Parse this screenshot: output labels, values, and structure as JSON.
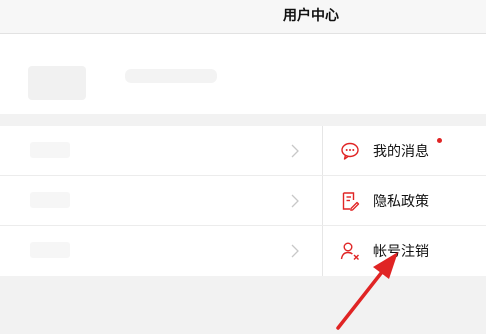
{
  "header": {
    "title": "用户中心"
  },
  "menu": {
    "items": [
      {
        "label": "我的消息",
        "icon": "message-icon",
        "has_unread_dot": true
      },
      {
        "label": "隐私政策",
        "icon": "policy-document-icon"
      },
      {
        "label": "帐号注销",
        "icon": "account-delete-icon"
      }
    ]
  },
  "colors": {
    "accent_red": "#e02424",
    "text_primary": "#111111",
    "background": "#f2f2f2",
    "chevron": "#c8c8c8"
  }
}
